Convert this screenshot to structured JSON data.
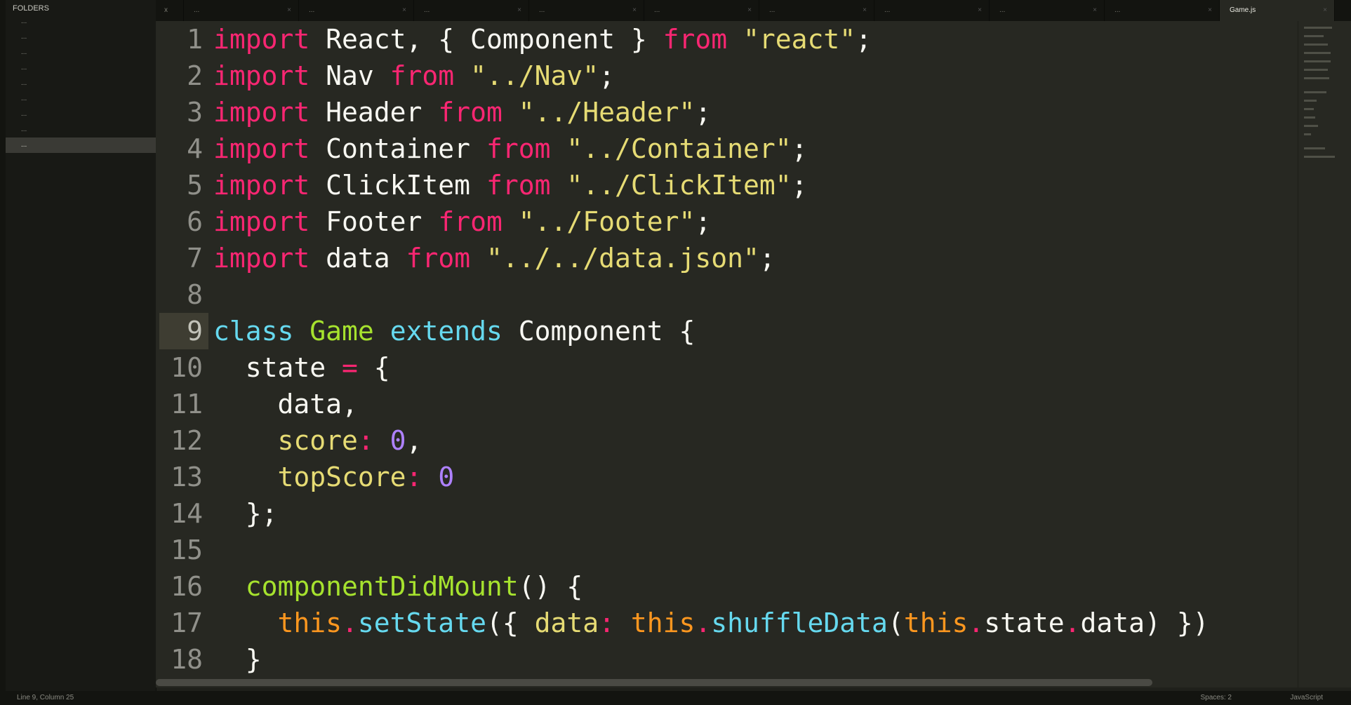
{
  "sidebar": {
    "title": "FOLDERS",
    "items": [
      {
        "label": "..."
      },
      {
        "label": "..."
      },
      {
        "label": "..."
      },
      {
        "label": "..."
      },
      {
        "label": "..."
      },
      {
        "label": "..."
      },
      {
        "label": "..."
      },
      {
        "label": "..."
      },
      {
        "label": "..."
      },
      {
        "label": "..."
      }
    ]
  },
  "tabs": [
    {
      "label": "x"
    },
    {
      "label": "..."
    },
    {
      "label": "..."
    },
    {
      "label": "..."
    },
    {
      "label": "..."
    },
    {
      "label": "..."
    },
    {
      "label": "..."
    },
    {
      "label": "..."
    },
    {
      "label": "..."
    },
    {
      "label": "..."
    },
    {
      "label": "Game.js"
    }
  ],
  "editor": {
    "current_line": 9,
    "lines": [
      {
        "n": "1"
      },
      {
        "n": "2"
      },
      {
        "n": "3"
      },
      {
        "n": "4"
      },
      {
        "n": "5"
      },
      {
        "n": "6"
      },
      {
        "n": "7"
      },
      {
        "n": "8"
      },
      {
        "n": "9"
      },
      {
        "n": "10"
      },
      {
        "n": "11"
      },
      {
        "n": "12"
      },
      {
        "n": "13"
      },
      {
        "n": "14"
      },
      {
        "n": "15"
      },
      {
        "n": "16"
      },
      {
        "n": "17"
      },
      {
        "n": "18"
      }
    ],
    "code": {
      "l1": [
        "import",
        " React, { Component } ",
        "from",
        " ",
        "\"react\"",
        ";"
      ],
      "l2": [
        "import",
        " Nav ",
        "from",
        " ",
        "\"../Nav\"",
        ";"
      ],
      "l3": [
        "import",
        " Header ",
        "from",
        " ",
        "\"../Header\"",
        ";"
      ],
      "l4": [
        "import",
        " Container ",
        "from",
        " ",
        "\"../Container\"",
        ";"
      ],
      "l5": [
        "import",
        " ClickItem ",
        "from",
        " ",
        "\"../ClickItem\"",
        ";"
      ],
      "l6": [
        "import",
        " Footer ",
        "from",
        " ",
        "\"../Footer\"",
        ";"
      ],
      "l7": [
        "import",
        " data ",
        "from",
        " ",
        "\"../../data.json\"",
        ";"
      ],
      "l9": [
        "class",
        " ",
        "Game",
        " ",
        "extends",
        " Component {"
      ],
      "l10": [
        "  state ",
        "=",
        " {"
      ],
      "l11": [
        "    data,"
      ],
      "l12": [
        "    ",
        "score",
        ": ",
        "0",
        ","
      ],
      "l13": [
        "    ",
        "topScore",
        ": ",
        "0"
      ],
      "l14": [
        "  };"
      ],
      "l16": [
        "  ",
        "componentDidMount",
        "() {"
      ],
      "l17": [
        "    ",
        "this",
        ".",
        "setState",
        "({ ",
        "data",
        ": ",
        "this",
        ".",
        "shuffleData",
        "(",
        "this",
        ".",
        "state",
        ".",
        "data",
        ") })"
      ],
      "l18": [
        "  }"
      ]
    }
  },
  "statusbar": {
    "left": "Line 9, Column 25",
    "spaces": "Spaces: 2",
    "syntax": "JavaScript"
  },
  "colors": {
    "keyword": "#f92672",
    "string": "#e6db74",
    "storage": "#66d9ef",
    "entity": "#a6e22e",
    "number": "#ae81ff",
    "variable": "#fd971f",
    "background": "#272822"
  }
}
